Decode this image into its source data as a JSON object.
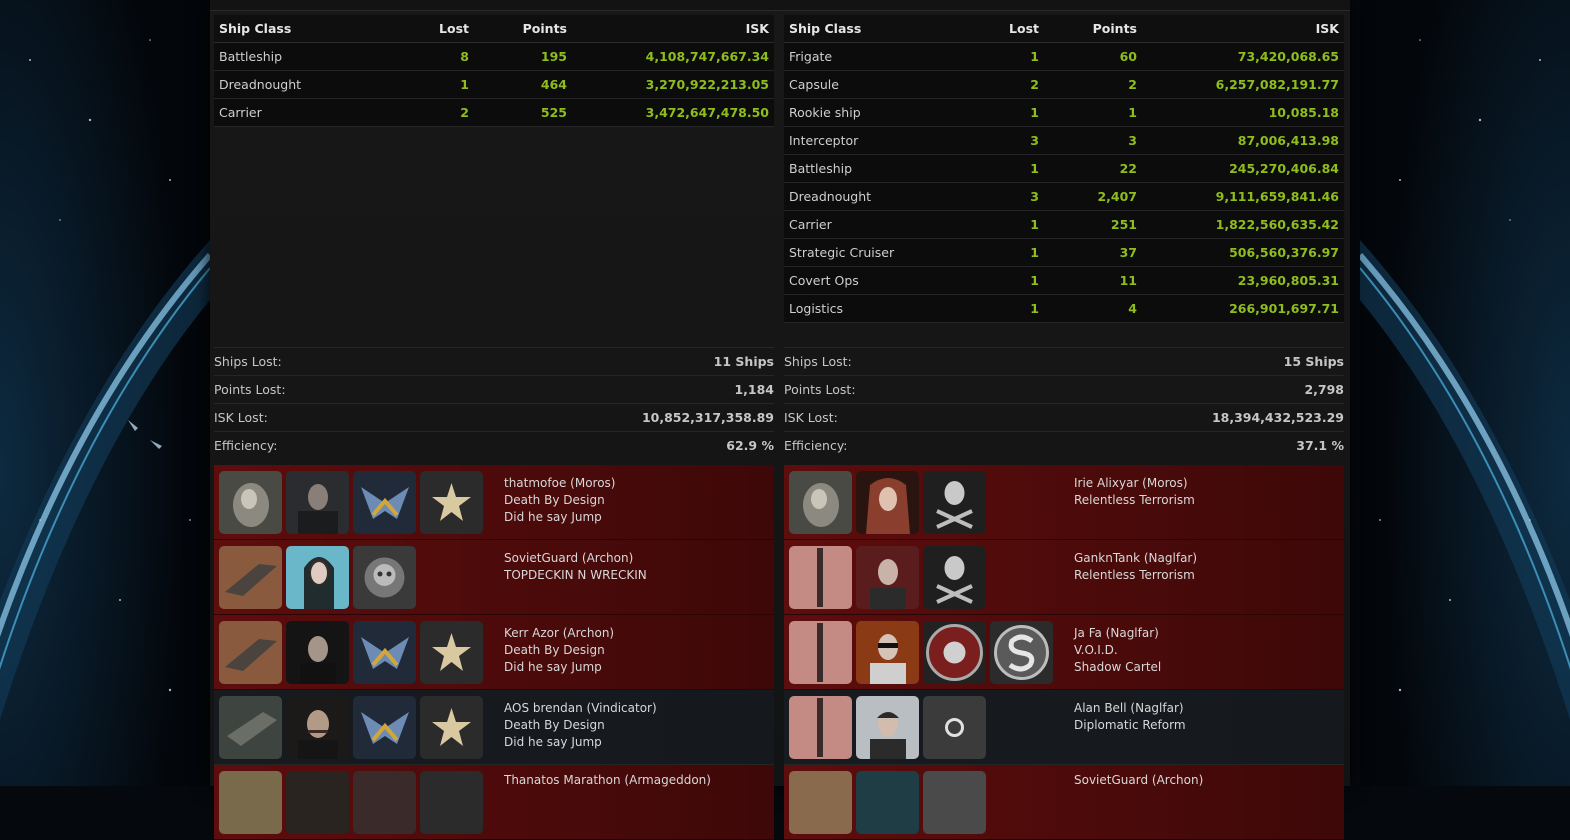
{
  "colors": {
    "accent_green": "#8fbd1b",
    "row_red": "#5e0d0d",
    "row_dark": "#171b20"
  },
  "tables": {
    "left": {
      "headers": {
        "class": "Ship Class",
        "lost": "Lost",
        "points": "Points",
        "isk": "ISK"
      },
      "rows": [
        {
          "class": "Battleship",
          "lost": "8",
          "points": "195",
          "isk": "4,108,747,667.34"
        },
        {
          "class": "Dreadnought",
          "lost": "1",
          "points": "464",
          "isk": "3,270,922,213.05"
        },
        {
          "class": "Carrier",
          "lost": "2",
          "points": "525",
          "isk": "3,472,647,478.50"
        }
      ]
    },
    "right": {
      "headers": {
        "class": "Ship Class",
        "lost": "Lost",
        "points": "Points",
        "isk": "ISK"
      },
      "rows": [
        {
          "class": "Frigate",
          "lost": "1",
          "points": "60",
          "isk": "73,420,068.65"
        },
        {
          "class": "Capsule",
          "lost": "2",
          "points": "2",
          "isk": "6,257,082,191.77"
        },
        {
          "class": "Rookie ship",
          "lost": "1",
          "points": "1",
          "isk": "10,085.18"
        },
        {
          "class": "Interceptor",
          "lost": "3",
          "points": "3",
          "isk": "87,006,413.98"
        },
        {
          "class": "Battleship",
          "lost": "1",
          "points": "22",
          "isk": "245,270,406.84"
        },
        {
          "class": "Dreadnought",
          "lost": "3",
          "points": "2,407",
          "isk": "9,111,659,841.46"
        },
        {
          "class": "Carrier",
          "lost": "1",
          "points": "251",
          "isk": "1,822,560,635.42"
        },
        {
          "class": "Strategic Cruiser",
          "lost": "1",
          "points": "37",
          "isk": "506,560,376.97"
        },
        {
          "class": "Covert Ops",
          "lost": "1",
          "points": "11",
          "isk": "23,960,805.31"
        },
        {
          "class": "Logistics",
          "lost": "1",
          "points": "4",
          "isk": "266,901,697.71"
        }
      ]
    }
  },
  "summary": {
    "left": [
      {
        "label": "Ships Lost:",
        "value": "11 Ships"
      },
      {
        "label": "Points Lost:",
        "value": "1,184"
      },
      {
        "label": "ISK Lost:",
        "value": "10,852,317,358.89"
      },
      {
        "label": "Efficiency:",
        "value": "62.9 %"
      }
    ],
    "right": [
      {
        "label": "Ships Lost:",
        "value": "15 Ships"
      },
      {
        "label": "Points Lost:",
        "value": "2,798"
      },
      {
        "label": "ISK Lost:",
        "value": "18,394,432,523.29"
      },
      {
        "label": "Efficiency:",
        "value": "37.1 %"
      }
    ]
  },
  "involved": {
    "left": [
      {
        "name": "thatmofoe (Moros)",
        "corp": "Death By Design",
        "alliance": "Did he say Jump",
        "loss": true,
        "icons": [
          "ship-moros-icon",
          "pilot-portrait",
          "corp-logo-icon",
          "alliance-star-logo-icon"
        ]
      },
      {
        "name": "SovietGuard (Archon)",
        "corp": "TOPDECKIN N WRECKIN",
        "alliance": "",
        "loss": true,
        "icons": [
          "ship-archon-icon",
          "pilot-portrait",
          "corp-skull-logo-icon"
        ]
      },
      {
        "name": "Kerr Azor (Archon)",
        "corp": "Death By Design",
        "alliance": "Did he say Jump",
        "loss": true,
        "icons": [
          "ship-archon-icon",
          "pilot-portrait",
          "corp-logo-icon",
          "alliance-star-logo-icon"
        ]
      },
      {
        "name": "AOS brendan (Vindicator)",
        "corp": "Death By Design",
        "alliance": "Did he say Jump",
        "loss": false,
        "icons": [
          "ship-vindicator-icon",
          "pilot-portrait",
          "corp-logo-icon",
          "alliance-star-logo-icon"
        ]
      },
      {
        "name": "Thanatos Marathon (Armageddon)",
        "corp": "",
        "alliance": "",
        "loss": true,
        "icons": [
          "ship-armageddon-icon",
          "pilot-portrait",
          "corp-logo-icon",
          "alliance-star-logo-icon"
        ]
      }
    ],
    "right": [
      {
        "name": "Irie Alixyar (Moros)",
        "corp": "Relentless Terrorism",
        "alliance": "",
        "loss": true,
        "icons": [
          "ship-moros-icon",
          "pilot-portrait",
          "corp-skull-crossbones-icon"
        ]
      },
      {
        "name": "GanknTank (Naglfar)",
        "corp": "Relentless Terrorism",
        "alliance": "",
        "loss": true,
        "icons": [
          "ship-naglfar-icon",
          "pilot-portrait",
          "corp-skull-crossbones-icon"
        ]
      },
      {
        "name": "Ja Fa (Naglfar)",
        "corp": "V.O.I.D.",
        "alliance": "Shadow Cartel",
        "loss": true,
        "icons": [
          "ship-naglfar-icon",
          "pilot-portrait",
          "corp-skull-target-icon",
          "alliance-s-logo-icon"
        ]
      },
      {
        "name": "Alan Bell (Naglfar)",
        "corp": "Diplomatic Reform",
        "alliance": "",
        "loss": false,
        "icons": [
          "ship-naglfar-icon",
          "pilot-portrait",
          "corp-ring-logo-icon"
        ]
      },
      {
        "name": "SovietGuard (Archon)",
        "corp": "",
        "alliance": "",
        "loss": true,
        "icons": [
          "ship-archon-icon",
          "pilot-portrait",
          "corp-logo-icon"
        ]
      }
    ]
  }
}
